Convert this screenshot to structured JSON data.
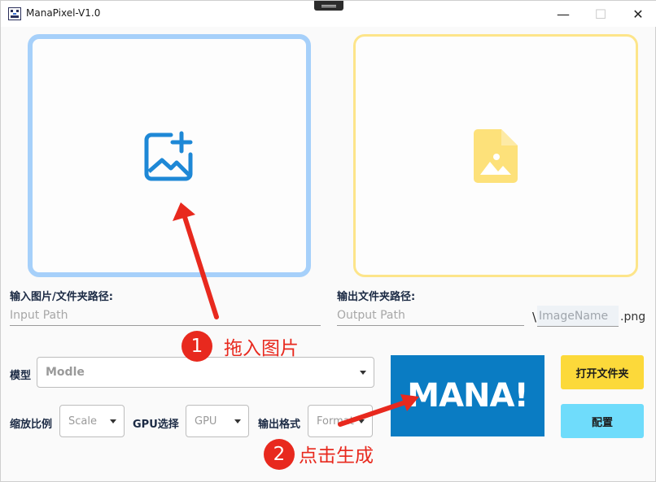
{
  "window": {
    "title": "ManaPixel-V1.0",
    "min": "—",
    "max": "☐",
    "close": "✕"
  },
  "input_zone": {
    "icon": "add-image-icon",
    "color": "#1e88d6"
  },
  "output_zone": {
    "icon": "image-file-icon",
    "color": "#fde17a"
  },
  "input_path": {
    "label": "输入图片/文件夹路径:",
    "placeholder": "Input Path"
  },
  "output_path": {
    "label": "输出文件夹路径:",
    "placeholder": "Output Path",
    "slash": "\\",
    "name_placeholder": "ImageName",
    "ext": ".png"
  },
  "model": {
    "label": "模型",
    "value": "Modle"
  },
  "scale": {
    "label": "缩放比例",
    "value": "Scale"
  },
  "gpu": {
    "label": "GPU选择",
    "value": "GPU"
  },
  "format": {
    "label": "输出格式",
    "value": "Format"
  },
  "mana_button": "MANA!",
  "open_folder_button": "打开文件夹",
  "config_button": "配置",
  "annotations": {
    "step1_number": "1",
    "step1_text": "拖入图片",
    "step2_number": "2",
    "step2_text": "点击生成",
    "color": "#e8291e"
  }
}
